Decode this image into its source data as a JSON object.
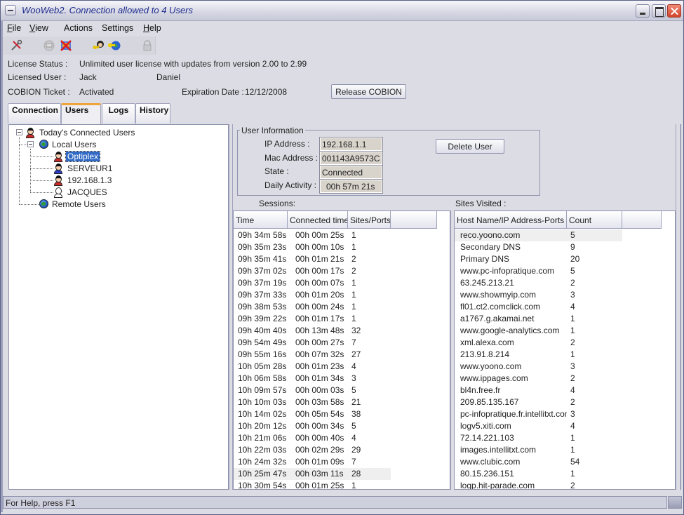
{
  "window": {
    "title": "WooWeb2. Connection allowed to 4 Users"
  },
  "menu": [
    {
      "label": "File",
      "mnemonic": "F",
      "rest": "ile"
    },
    {
      "label": "View",
      "mnemonic": "V",
      "rest": "iew"
    },
    {
      "label": "Actions",
      "mnemonic": "",
      "rest": "Actions"
    },
    {
      "label": "Settings",
      "mnemonic": "",
      "rest": "Settings"
    },
    {
      "label": "Help",
      "mnemonic": "H",
      "rest": "elp"
    }
  ],
  "toolbar": [
    {
      "icon": "tools-icon",
      "glyph": "⚒",
      "enabled": true
    },
    {
      "icon": "computer-icon",
      "glyph": "⎚",
      "enabled": false
    },
    {
      "icon": "disconnect-icon",
      "glyph": "✖",
      "enabled": true
    },
    {
      "icon": "user-key-icon",
      "glyph": "☻",
      "enabled": true
    },
    {
      "icon": "globe-key-icon",
      "glyph": "⚿",
      "enabled": true
    },
    {
      "icon": "lock-icon",
      "glyph": "🔒",
      "enabled": false
    }
  ],
  "license": {
    "status_label": "License Status :",
    "status_value": "Unlimited user license with updates from version 2.00 to 2.99",
    "user_label": "Licensed User :",
    "user_first": "Jack",
    "user_last": "Daniel",
    "ticket_label": "COBION Ticket :",
    "ticket_value": "Activated",
    "expiration_label": "Expiration Date :",
    "expiration_value": "12/12/2008",
    "release_button": "Release COBION"
  },
  "tabs": [
    {
      "label": "Connection",
      "active": false
    },
    {
      "label": "Users",
      "active": true
    },
    {
      "label": "Logs",
      "active": false
    },
    {
      "label": "History",
      "active": false
    }
  ],
  "tree": {
    "root": "Today's Connected Users",
    "local": "Local Users",
    "local_users": [
      {
        "name": "Optiplex",
        "selected": true,
        "style": "red"
      },
      {
        "name": "SERVEUR1",
        "selected": false,
        "style": "blue"
      },
      {
        "name": "192.168.1.3",
        "selected": false,
        "style": "red"
      },
      {
        "name": "JACQUES",
        "selected": false,
        "style": "ghost"
      }
    ],
    "remote": "Remote Users"
  },
  "user_info": {
    "legend": "User Information",
    "ip_label": "IP Address :",
    "ip_value": "192.168.1.1",
    "mac_label": "Mac Address :",
    "mac_value": "001143A9573C",
    "state_label": "State :",
    "state_value": "Connected",
    "activity_label": "Daily Activity :",
    "activity_value": "00h 57m 21s",
    "delete_button": "Delete User"
  },
  "sessions": {
    "label": "Sessions:",
    "columns": [
      "Time",
      "Connected time",
      "Sites/Ports"
    ],
    "rows": [
      [
        "09h 34m 58s",
        "00h 00m 25s",
        "1"
      ],
      [
        "09h 35m 23s",
        "00h 00m 10s",
        "1"
      ],
      [
        "09h 35m 41s",
        "00h 01m 21s",
        "2"
      ],
      [
        "09h 37m 02s",
        "00h 00m 17s",
        "2"
      ],
      [
        "09h 37m 19s",
        "00h 00m 07s",
        "1"
      ],
      [
        "09h 37m 33s",
        "00h 01m 20s",
        "1"
      ],
      [
        "09h 38m 53s",
        "00h 00m 24s",
        "1"
      ],
      [
        "09h 39m 22s",
        "00h 01m 17s",
        "1"
      ],
      [
        "09h 40m 40s",
        "00h 13m 48s",
        "32"
      ],
      [
        "09h 54m 49s",
        "00h 00m 27s",
        "7"
      ],
      [
        "09h 55m 16s",
        "00h 07m 32s",
        "27"
      ],
      [
        "10h 05m 28s",
        "00h 01m 23s",
        "4"
      ],
      [
        "10h 06m 58s",
        "00h 01m 34s",
        "3"
      ],
      [
        "10h 09m 57s",
        "00h 00m 03s",
        "5"
      ],
      [
        "10h 10m 03s",
        "00h 03m 58s",
        "21"
      ],
      [
        "10h 14m 02s",
        "00h 05m 54s",
        "38"
      ],
      [
        "10h 20m 12s",
        "00h 00m 34s",
        "5"
      ],
      [
        "10h 21m 06s",
        "00h 00m 40s",
        "4"
      ],
      [
        "10h 22m 03s",
        "00h 02m 29s",
        "29"
      ],
      [
        "10h 24m 32s",
        "00h 01m 09s",
        "7"
      ],
      [
        "10h 25m 47s",
        "00h 03m 11s",
        "28"
      ],
      [
        "10h 30m 54s",
        "00h 01m 25s",
        "1"
      ]
    ],
    "highlighted_row": 20
  },
  "sites": {
    "label": "Sites Visited :",
    "columns": [
      "Host Name/IP Address-Ports N...",
      "Count"
    ],
    "rows": [
      [
        "reco.yoono.com",
        "5"
      ],
      [
        "Secondary DNS",
        "9"
      ],
      [
        "Primary DNS",
        "20"
      ],
      [
        "www.pc-infopratique.com",
        "5"
      ],
      [
        "63.245.213.21",
        "2"
      ],
      [
        "www.showmyip.com",
        "3"
      ],
      [
        "fl01.ct2.comclick.com",
        "4"
      ],
      [
        "a1767.g.akamai.net",
        "1"
      ],
      [
        "www.google-analytics.com",
        "1"
      ],
      [
        "xml.alexa.com",
        "2"
      ],
      [
        "213.91.8.214",
        "1"
      ],
      [
        "www.yoono.com",
        "3"
      ],
      [
        "www.ippages.com",
        "2"
      ],
      [
        "bl4n.free.fr",
        "4"
      ],
      [
        "209.85.135.167",
        "2"
      ],
      [
        "pc-infopratique.fr.intellitxt.com",
        "3"
      ],
      [
        "logv5.xiti.com",
        "4"
      ],
      [
        "72.14.221.103",
        "1"
      ],
      [
        "images.intellitxt.com",
        "1"
      ],
      [
        "www.clubic.com",
        "54"
      ],
      [
        "80.15.236.151",
        "1"
      ],
      [
        "logp.hit-parade.com",
        "2"
      ]
    ],
    "highlighted_row": 0
  },
  "statusbar": {
    "text": "For Help, press F1"
  }
}
